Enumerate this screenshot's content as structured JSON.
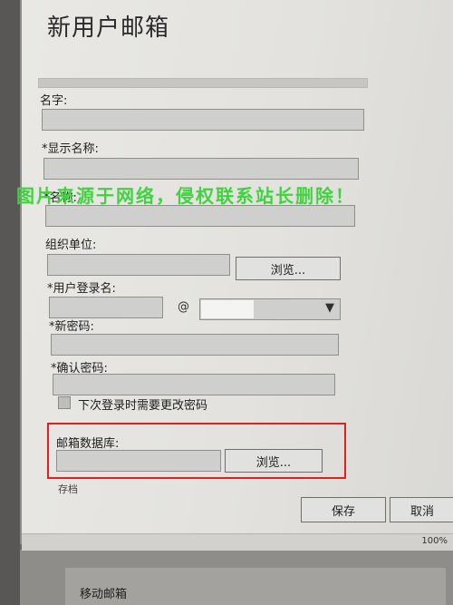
{
  "dialog": {
    "title": "新用户邮箱"
  },
  "form": {
    "name_label": "名字:",
    "display_name_label": "*显示名称:",
    "alias_label": "*名称:",
    "org_unit_label": "组织单位:",
    "org_browse_button": "浏览...",
    "logon_name_label": "*用户登录名:",
    "at_sign": "@",
    "new_password_label": "*新密码:",
    "confirm_password_label": "*确认密码:",
    "change_password_checkbox_label": "下次登录时需要更改密码",
    "mailbox_db_label": "邮箱数据库:",
    "db_browse_button": "浏览...",
    "archive_label": "存档"
  },
  "actions": {
    "save_label": "保存",
    "cancel_label": "取消"
  },
  "status": {
    "zoom": "100%"
  },
  "background": {
    "mobile_mailbox_label": "移动邮箱"
  },
  "overlay": {
    "watermark_text": "图片来源于网络，侵权联系站长删除！"
  },
  "colors": {
    "highlight_border": "#e02020",
    "watermark": "#3fd33f"
  }
}
